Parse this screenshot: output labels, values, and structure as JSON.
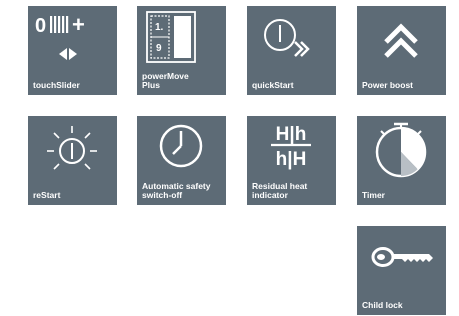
{
  "tiles": [
    {
      "label": "touchSlider",
      "icon": "touchslider-icon"
    },
    {
      "label": "powerMove\nPlus",
      "icon": "powermove-plus-icon",
      "zones": [
        "1.",
        "9"
      ]
    },
    {
      "label": "quickStart",
      "icon": "quickstart-icon"
    },
    {
      "label": "Power boost",
      "icon": "power-boost-icon"
    },
    {
      "label": "reStart",
      "icon": "restart-icon"
    },
    {
      "label": "Automatic safety\nswitch-off",
      "icon": "automatic-safety-switch-off-icon"
    },
    {
      "label": "Residual heat\nindicator",
      "icon": "residual-heat-indicator-icon",
      "symbol_top": "H|h",
      "symbol_bottom": "h|H"
    },
    {
      "label": "Timer",
      "icon": "timer-icon"
    },
    {
      "label": "Child lock",
      "icon": "child-lock-icon"
    }
  ],
  "colors": {
    "tile_background": "#5d6b76",
    "foreground": "#ffffff",
    "page_background": "#ffffff"
  }
}
